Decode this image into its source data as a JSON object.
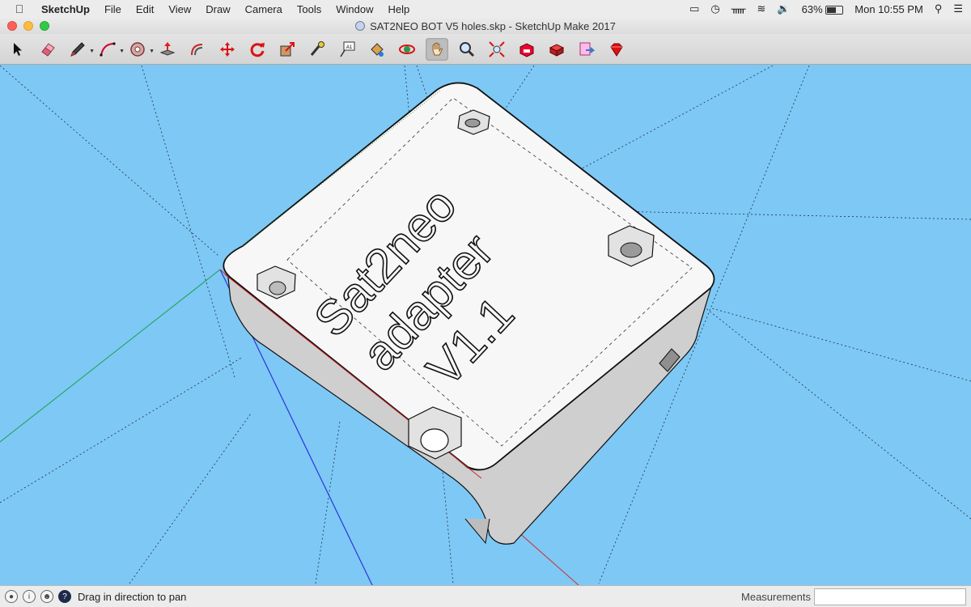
{
  "menubar": {
    "app_name": "SketchUp",
    "menus": [
      "File",
      "Edit",
      "View",
      "Draw",
      "Camera",
      "Tools",
      "Window",
      "Help"
    ],
    "battery": "63%",
    "clock": "Mon 10:55 PM"
  },
  "window": {
    "title": "SAT2NEO BOT V5 holes.skp - SketchUp Make 2017"
  },
  "toolbar": {
    "tools": [
      {
        "name": "select-tool"
      },
      {
        "name": "eraser-tool"
      },
      {
        "name": "line-tool"
      },
      {
        "name": "arc-tool"
      },
      {
        "name": "shapes-tool"
      },
      {
        "name": "push-pull-tool"
      },
      {
        "name": "offset-tool"
      },
      {
        "name": "move-tool"
      },
      {
        "name": "rotate-tool"
      },
      {
        "name": "scale-tool"
      },
      {
        "name": "tape-measure-tool"
      },
      {
        "name": "text-tool"
      },
      {
        "name": "paint-bucket-tool"
      },
      {
        "name": "orbit-tool"
      },
      {
        "name": "pan-tool",
        "active": true
      },
      {
        "name": "zoom-tool"
      },
      {
        "name": "zoom-extents-tool"
      },
      {
        "name": "warehouse-tool"
      },
      {
        "name": "extension-warehouse-tool"
      },
      {
        "name": "layout-tool"
      },
      {
        "name": "ruby-tool"
      }
    ]
  },
  "model": {
    "engraving": [
      "Sat2neo",
      "adapter",
      "V1.1"
    ]
  },
  "statusbar": {
    "hint": "Drag in direction to pan",
    "measurements_label": "Measurements",
    "measurements_value": ""
  }
}
